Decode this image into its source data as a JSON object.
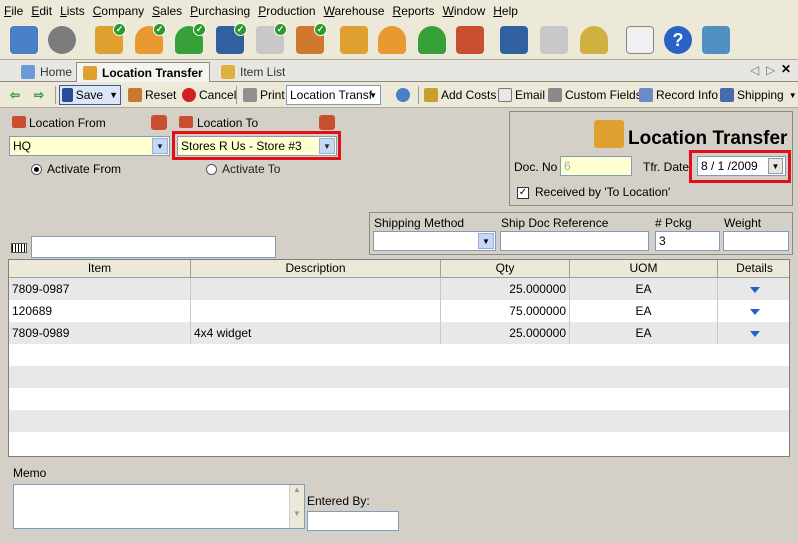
{
  "menu": [
    "File",
    "Edit",
    "Lists",
    "Company",
    "Sales",
    "Purchasing",
    "Production",
    "Warehouse",
    "Reports",
    "Window",
    "Help"
  ],
  "tabs": {
    "home": "Home",
    "location_transfer": "Location Transfer",
    "item_list": "Item List"
  },
  "toolbar": {
    "save": "Save",
    "reset": "Reset",
    "cancel": "Cancel",
    "print": "Print",
    "print_form": "Location Transf",
    "add_costs": "Add Costs",
    "email": "Email",
    "custom_fields": "Custom Fields",
    "record_info": "Record Info",
    "shipping": "Shipping"
  },
  "form": {
    "location_from_label": "Location From",
    "location_from_value": "HQ",
    "location_to_label": "Location To",
    "location_to_value": "Stores R Us - Store #3",
    "activate_from": "Activate From",
    "activate_to": "Activate To",
    "title": "Location Transfer",
    "doc_no_label": "Doc. No",
    "doc_no_value": "6",
    "tfr_date_label": "Tfr. Date",
    "tfr_date_value": "8 / 1 /2009",
    "received_label": "Received by 'To Location'",
    "shipping_method_label": "Shipping Method",
    "shipping_method_value": "",
    "ship_doc_label": "Ship Doc Reference",
    "ship_doc_value": "",
    "pckg_label": "# Pckg",
    "pckg_value": "3",
    "weight_label": "Weight",
    "weight_value": ""
  },
  "grid": {
    "headers": {
      "item": "Item",
      "description": "Description",
      "qty": "Qty",
      "uom": "UOM",
      "details": "Details"
    },
    "rows": [
      {
        "item": "7809-0987",
        "description": "",
        "qty": "25.000000",
        "uom": "EA"
      },
      {
        "item": "120689",
        "description": "",
        "qty": "75.000000",
        "uom": "EA"
      },
      {
        "item": "7809-0989",
        "description": "4x4 widget",
        "qty": "25.000000",
        "uom": "EA"
      }
    ]
  },
  "memo": {
    "label": "Memo",
    "value": "",
    "entered_by_label": "Entered By:",
    "entered_by_value": ""
  }
}
